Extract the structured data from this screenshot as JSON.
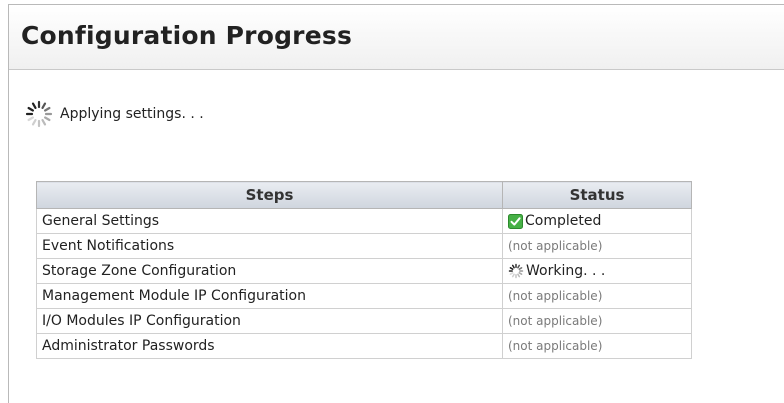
{
  "header": {
    "title": "Configuration Progress"
  },
  "progress": {
    "message": "Applying settings. . ."
  },
  "table": {
    "headers": {
      "steps": "Steps",
      "status": "Status"
    },
    "rows": [
      {
        "step": "General Settings",
        "status": "Completed",
        "state": "completed",
        "icon": "check-icon"
      },
      {
        "step": "Event Notifications",
        "status": "(not applicable)",
        "state": "na"
      },
      {
        "step": "Storage Zone Configuration",
        "status": "Working. . .",
        "state": "working",
        "icon": "spinner-icon"
      },
      {
        "step": "Management Module IP Configuration",
        "status": "(not applicable)",
        "state": "na"
      },
      {
        "step": "I/O Modules IP Configuration",
        "status": "(not applicable)",
        "state": "na"
      },
      {
        "step": "Administrator Passwords",
        "status": "(not applicable)",
        "state": "na"
      }
    ]
  },
  "colors": {
    "check": "#3aa83a",
    "muted": "#7a7a7a"
  }
}
